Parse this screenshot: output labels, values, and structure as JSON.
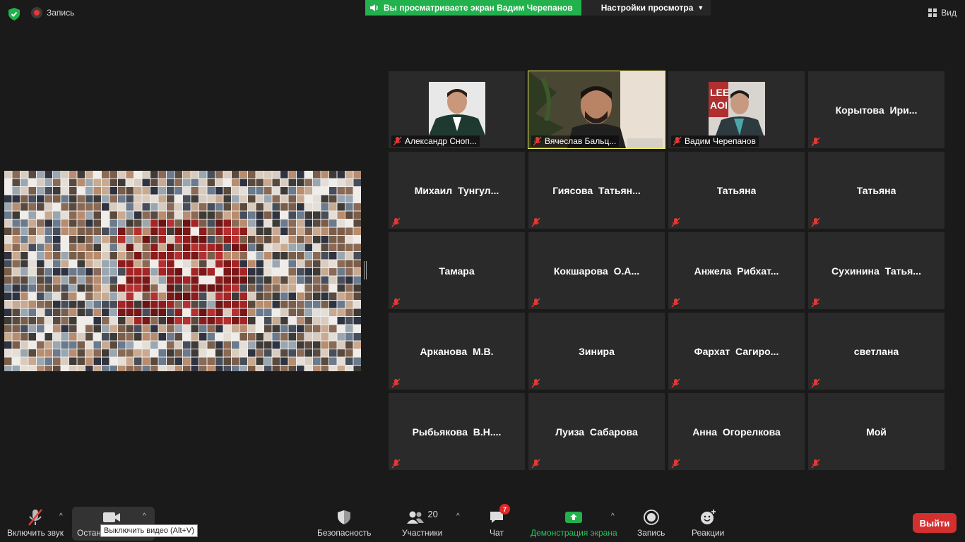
{
  "top": {
    "recording_label": "Запись",
    "share_banner": "Вы просматриваете экран Вадим Черепанов",
    "view_options": "Настройки просмотра",
    "view_button": "Вид"
  },
  "colors": {
    "share_green": "#22b14c",
    "active_speaker": "#f2f066",
    "muted_red": "#e53935",
    "exit_red": "#d32f2f"
  },
  "tiles": [
    {
      "name": "Александр Сноп...",
      "video": true
    },
    {
      "name": "Вячеслав Бальц...",
      "video": true,
      "active": true
    },
    {
      "name": "Вадим Черепанов",
      "video": true
    },
    {
      "name": "Корытова Ири..."
    },
    {
      "name": "Михаил Тунгул..."
    },
    {
      "name": "Гиясова Татьян..."
    },
    {
      "name": "Татьяна"
    },
    {
      "name": "Татьяна"
    },
    {
      "name": "Тамара"
    },
    {
      "name": "Кокшарова О.А..."
    },
    {
      "name": "Анжела Рибхат..."
    },
    {
      "name": "Сухинина Татья..."
    },
    {
      "name": "Арканова М.В."
    },
    {
      "name": "Зинира"
    },
    {
      "name": "Фархат Сагиро..."
    },
    {
      "name": "светлана"
    },
    {
      "name": "Рыбьякова В.Н...."
    },
    {
      "name": "Луиза Сабарова"
    },
    {
      "name": "Анна Огорелкова"
    },
    {
      "name": "Мой"
    }
  ],
  "toolbar": {
    "unmute": "Включить звук",
    "stop_video": "Остан",
    "security": "Безопасность",
    "participants": "Участники",
    "participants_count": "20",
    "chat": "Чат",
    "chat_badge": "7",
    "share_screen": "Демонстрация экрана",
    "record": "Запись",
    "reactions": "Реакции",
    "exit": "Выйти",
    "tooltip": "Выключить видео (Alt+V)"
  }
}
